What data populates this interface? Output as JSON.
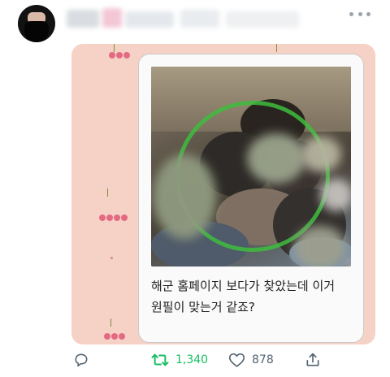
{
  "tweet": {
    "image_caption_lines": [
      "해군 홈페이지 보다가 찾았는데 이거",
      "원필이 맞는거 같죠?"
    ]
  },
  "actions": {
    "reply": {
      "icon": "reply-icon"
    },
    "retweet": {
      "icon": "retweet-icon",
      "count": "1,340",
      "color": "#17bf63"
    },
    "like": {
      "icon": "heart-icon",
      "count": "878"
    },
    "share": {
      "icon": "share-icon"
    }
  },
  "colors": {
    "media_background": "#f6d1c6",
    "cherry": "#e46a84",
    "retweet_active": "#17bf63",
    "icon_gray": "#536471"
  }
}
